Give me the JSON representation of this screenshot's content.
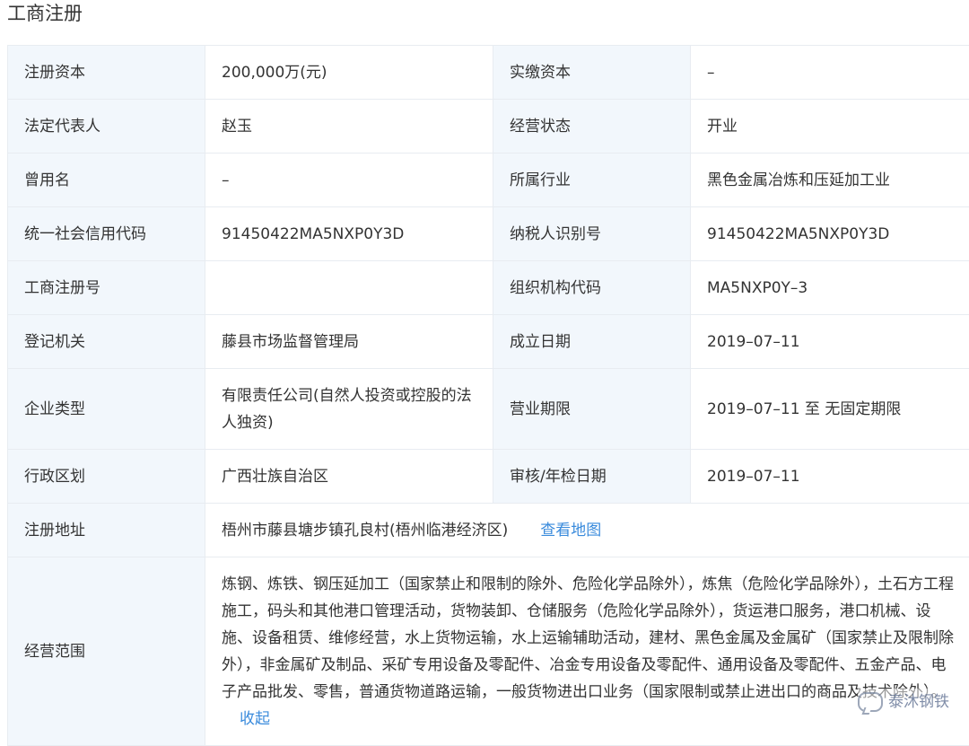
{
  "page_title": "工商注册",
  "rows": [
    {
      "l1": "注册资本",
      "v1": "200,000万(元)",
      "l2": "实缴资本",
      "v2": "–"
    },
    {
      "l1": "法定代表人",
      "v1": "赵玉",
      "l2": "经营状态",
      "v2": "开业"
    },
    {
      "l1": "曾用名",
      "v1": "–",
      "l2": "所属行业",
      "v2": "黑色金属冶炼和压延加工业"
    },
    {
      "l1": "统一社会信用代码",
      "v1": "91450422MA5NXP0Y3D",
      "l2": "纳税人识别号",
      "v2": "91450422MA5NXP0Y3D"
    },
    {
      "l1": "工商注册号",
      "v1": "",
      "l2": "组织机构代码",
      "v2": "MA5NXP0Y–3"
    },
    {
      "l1": "登记机关",
      "v1": "藤县市场监督管理局",
      "l2": "成立日期",
      "v2": "2019–07–11"
    },
    {
      "l1": "企业类型",
      "v1": "有限责任公司(自然人投资或控股的法人独资)",
      "l2": "营业期限",
      "v2": "2019–07–11 至 无固定期限"
    },
    {
      "l1": "行政区划",
      "v1": "广西壮族自治区",
      "l2": "审核/年检日期",
      "v2": "2019–07–11"
    }
  ],
  "address": {
    "label": "注册地址",
    "value": "梧州市藤县塘步镇孔良村(梧州临港经济区)",
    "map_link": "查看地图"
  },
  "scope": {
    "label": "经营范围",
    "text": "炼钢、炼铁、钢压延加工（国家禁止和限制的除外、危险化学品除外），炼焦（危险化学品除外），土石方工程施工，码头和其他港口管理活动，货物装卸、仓储服务（危险化学品除外），货运港口服务，港口机械、设施、设备租赁、维修经营，水上货物运输，水上运输辅助活动，建材、黑色金属及金属矿（国家禁止及限制除外），非金属矿及制品、采矿专用设备及零配件、冶金专用设备及零配件、通用设备及零配件、五金产品、电子产品批发、零售，普通货物道路运输，一般货物进出口业务（国家限制或禁止进出口的商品及技术除外）。",
    "collapse_link": "收起"
  },
  "watermark": "泰沐钢铁"
}
